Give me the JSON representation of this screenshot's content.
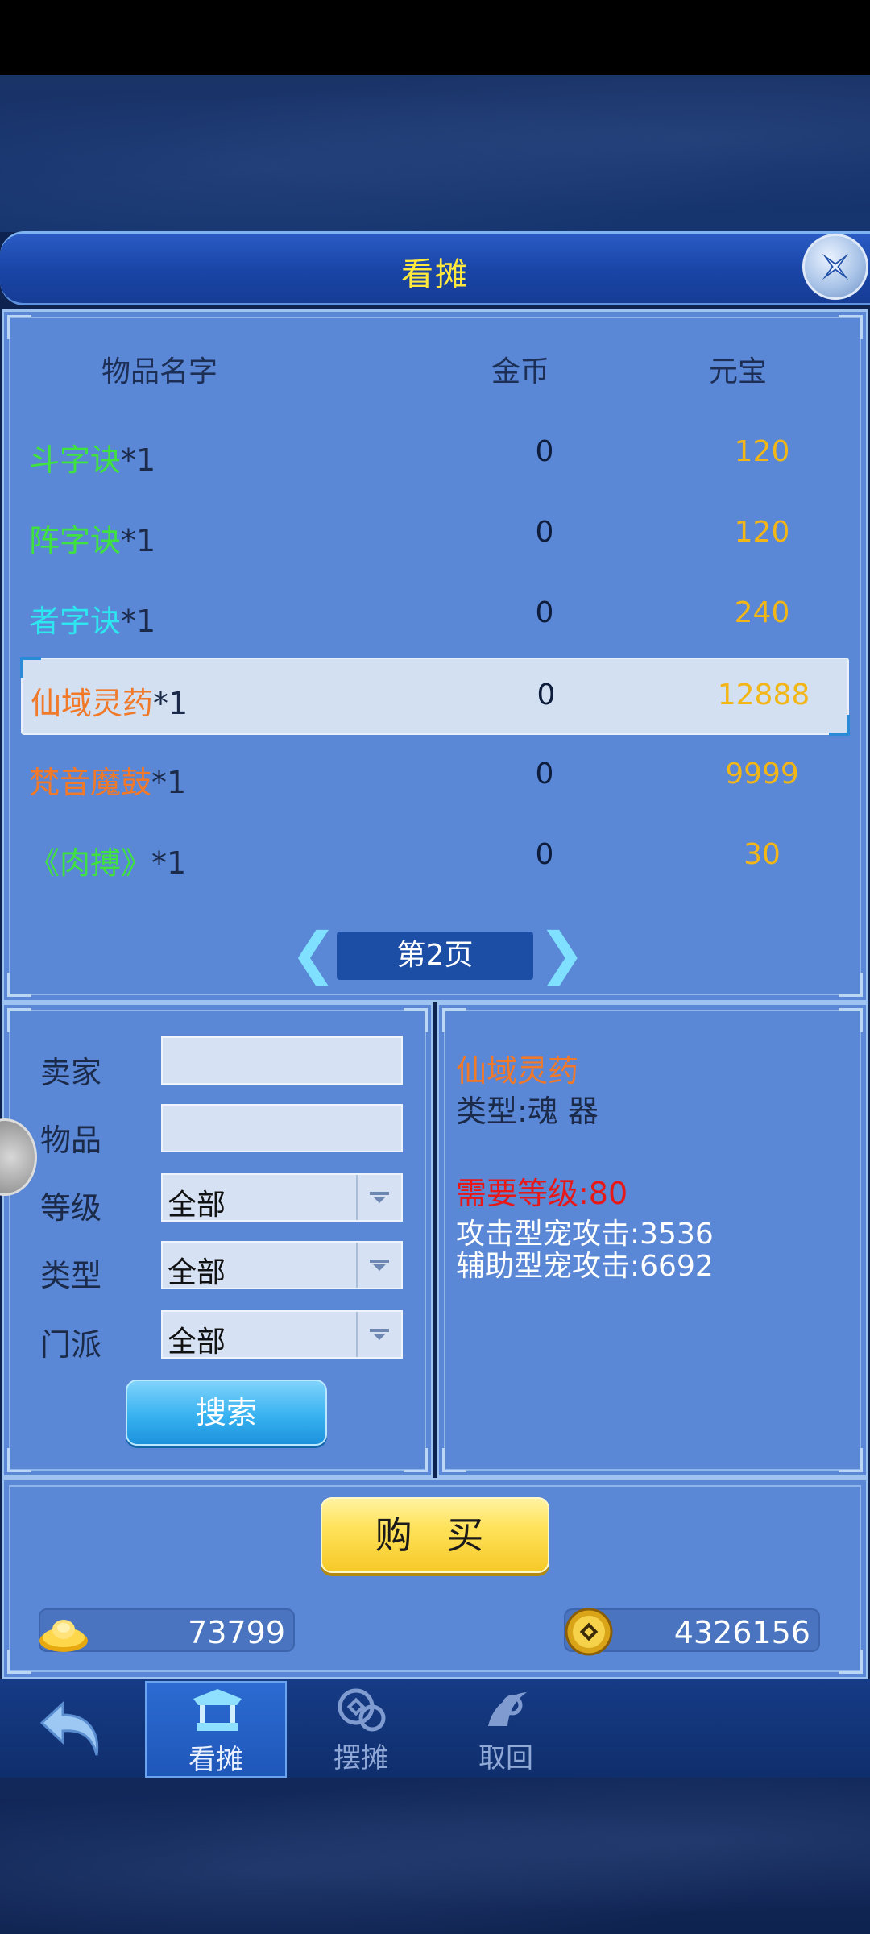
{
  "title": "看摊",
  "columns": {
    "name": "物品名字",
    "gold": "金币",
    "yuanbao": "元宝"
  },
  "items": [
    {
      "name": "斗字诀",
      "qty": "*1",
      "gold": "0",
      "yuanbao": "120",
      "color": "#3fe23f"
    },
    {
      "name": "阵字诀",
      "qty": "*1",
      "gold": "0",
      "yuanbao": "120",
      "color": "#3fe23f"
    },
    {
      "name": "者字诀",
      "qty": "*1",
      "gold": "0",
      "yuanbao": "240",
      "color": "#2ee6ef"
    },
    {
      "name": "仙域灵药",
      "qty": "*1",
      "gold": "0",
      "yuanbao": "12888",
      "color": "#f0792a",
      "selected": true
    },
    {
      "name": "梵音魔鼓",
      "qty": "*1",
      "gold": "0",
      "yuanbao": "9999",
      "color": "#f0792a"
    },
    {
      "name": "《肉搏》",
      "qty": "*1",
      "gold": "0",
      "yuanbao": "30",
      "color": "#3fe23f"
    }
  ],
  "pager": {
    "label": "第2页"
  },
  "search": {
    "seller_label": "卖家",
    "item_label": "物品",
    "level_label": "等级",
    "level_value": "全部",
    "type_label": "类型",
    "type_value": "全部",
    "sect_label": "门派",
    "sect_value": "全部",
    "button": "搜索"
  },
  "detail": {
    "name": "仙域灵药",
    "type": "类型:魂 器",
    "required_level": "需要等级:80",
    "attack_pet": "攻击型宠攻击:3536",
    "support_pet": "辅助型宠攻击:6692"
  },
  "buy_button": "购 买",
  "wallet": {
    "yuanbao": "73799",
    "gold": "4326156"
  },
  "nav": {
    "browse": "看摊",
    "stall": "摆摊",
    "retrieve": "取回"
  },
  "colors": {
    "title_text": "#ffe93d",
    "yuanbao_text": "#f2b617",
    "required_level": "#e81818"
  }
}
